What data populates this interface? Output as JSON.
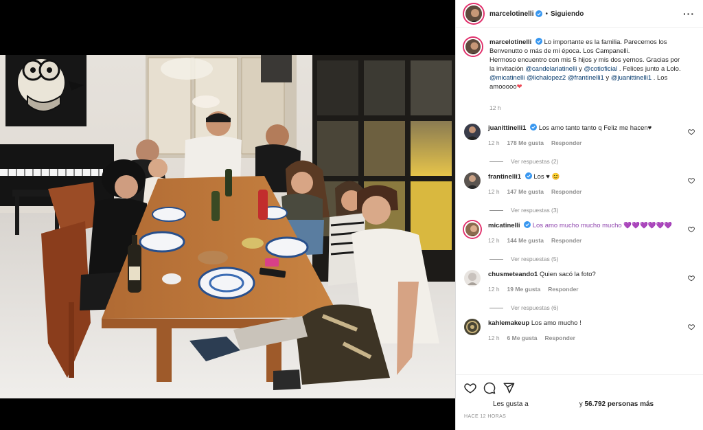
{
  "post": {
    "username": "marcelotinelli",
    "separator": "•",
    "follow_status": "Siguiendo",
    "more_icon": "more-horizontal-icon"
  },
  "caption": {
    "username": "marcelotinelli",
    "text1": "Lo importante es la familia. Parecemos los Benvenutto o más de mi época. Los Campanelli.",
    "text2": "Hermoso encuentro con mis 5 hijos y mis dos yernos. Gracias por la invitación",
    "mention1": "@candelariatinelli",
    "y1": "y",
    "mention2": "@cotioficial",
    "text3": ". Felices junto a Lolo.",
    "mention3": "@micatinelli",
    "mention4": "@lichalopez2",
    "mention5": "@frantinelli1",
    "y2": "y",
    "mention6": "@juanittinelli1",
    "text4": ". Los amooooo",
    "emoji": "❤",
    "time": "12 h"
  },
  "comments": [
    {
      "user": "juanittinelli1",
      "verified": true,
      "text": "Los amo tanto tanto q Feliz me hacen♥",
      "time": "12 h",
      "likes": "178 Me gusta",
      "reply": "Responder",
      "view": "Ver respuestas (2)",
      "avatar_color": "#3a3d4a"
    },
    {
      "user": "frantinelli1",
      "verified": true,
      "text": "Los ♥ 😊",
      "time": "12 h",
      "likes": "147 Me gusta",
      "reply": "Responder",
      "view": "Ver respuestas (3)",
      "avatar_color": "#5b5550"
    },
    {
      "user": "micatinelli",
      "verified": true,
      "text": "Los amo mucho mucho mucho 💜💜💜💜💜💜",
      "time": "12 h",
      "likes": "144 Me gusta",
      "reply": "Responder",
      "view": "Ver respuestas (5)",
      "avatar_color": "#8a6a4e"
    },
    {
      "user": "chusmeteando1",
      "verified": false,
      "text": "Quien sacó la foto?",
      "time": "12 h",
      "likes": "19 Me gusta",
      "reply": "Responder",
      "view": "Ver respuestas (6)",
      "avatar_color": "#c9c2bd"
    },
    {
      "user": "kahlemakeup",
      "verified": false,
      "text": "Los amo mucho !",
      "time": "12 h",
      "likes": "6 Me gusta",
      "reply": "Responder",
      "view": "",
      "avatar_color": "#4a4634"
    }
  ],
  "footer": {
    "likes_prefix": "Les gusta a",
    "likes_suffix_a": "y",
    "likes_count": "56.792 personas más",
    "time_ago": "HACE 12 HORAS"
  },
  "colors": {
    "link": "#00376b",
    "verified": "#3897f0",
    "meta": "#8e8e8e",
    "border": "#dbdbdb"
  }
}
